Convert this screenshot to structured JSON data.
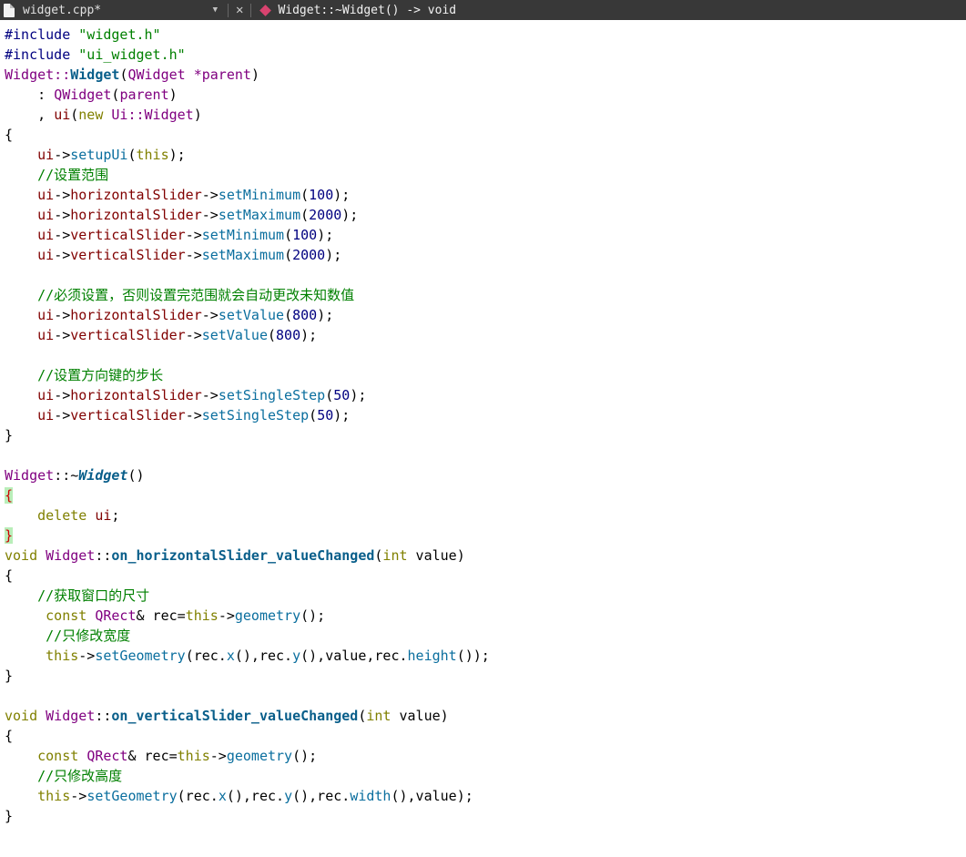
{
  "titlebar": {
    "file_tab": "widget.cpp*",
    "context": "Widget::~Widget() -> void",
    "icons": {
      "file": "document-icon",
      "dropdown_glyph": "▼",
      "close_glyph": "✕",
      "symbol": "function-diamond-icon"
    }
  },
  "colors": {
    "titlebar_bg": "#383838",
    "editor_bg": "#ffffff",
    "diamond": "#d9436f",
    "keyword": "#808000",
    "preprocessor": "#000080",
    "number": "#000080",
    "string": "#008000",
    "comment": "#008000",
    "type": "#800080",
    "field": "#800000",
    "function": "#0a6e9e",
    "function_decl": "#085e8a",
    "brace_match": "#d00000",
    "brace_match_bg": "#b9eeb9"
  },
  "code": {
    "language": "cpp",
    "lines": [
      {
        "tokens": [
          [
            "pp",
            "#include"
          ],
          [
            "pl",
            " "
          ],
          [
            "str",
            "\"widget.h\""
          ]
        ]
      },
      {
        "tokens": [
          [
            "pp",
            "#include"
          ],
          [
            "pl",
            " "
          ],
          [
            "str",
            "\"ui_widget.h\""
          ]
        ]
      },
      {
        "tokens": [
          [
            "type",
            "Widget::"
          ],
          [
            "fndecl",
            "Widget"
          ],
          [
            "pl",
            "("
          ],
          [
            "type",
            "QWidget *parent"
          ],
          [
            "pl",
            ")"
          ]
        ]
      },
      {
        "tokens": [
          [
            "pl",
            "    : "
          ],
          [
            "type",
            "QWidget"
          ],
          [
            "pl",
            "("
          ],
          [
            "type",
            "parent"
          ],
          [
            "pl",
            ")"
          ]
        ]
      },
      {
        "tokens": [
          [
            "pl",
            "    , "
          ],
          [
            "field",
            "ui"
          ],
          [
            "pl",
            "("
          ],
          [
            "kw",
            "new"
          ],
          [
            "pl",
            " "
          ],
          [
            "type",
            "Ui::Widget"
          ],
          [
            "pl",
            ")"
          ]
        ]
      },
      {
        "tokens": [
          [
            "pl",
            "{"
          ]
        ]
      },
      {
        "tokens": [
          [
            "pl",
            "    "
          ],
          [
            "field",
            "ui"
          ],
          [
            "pl",
            "->"
          ],
          [
            "fn",
            "setupUi"
          ],
          [
            "pl",
            "("
          ],
          [
            "kw",
            "this"
          ],
          [
            "pl",
            ");"
          ]
        ]
      },
      {
        "tokens": [
          [
            "cmt",
            "    //设置范围"
          ]
        ]
      },
      {
        "tokens": [
          [
            "pl",
            "    "
          ],
          [
            "field",
            "ui"
          ],
          [
            "pl",
            "->"
          ],
          [
            "field",
            "horizontalSlider"
          ],
          [
            "pl",
            "->"
          ],
          [
            "fn",
            "setMinimum"
          ],
          [
            "pl",
            "("
          ],
          [
            "num",
            "100"
          ],
          [
            "pl",
            ");"
          ]
        ]
      },
      {
        "tokens": [
          [
            "pl",
            "    "
          ],
          [
            "field",
            "ui"
          ],
          [
            "pl",
            "->"
          ],
          [
            "field",
            "horizontalSlider"
          ],
          [
            "pl",
            "->"
          ],
          [
            "fn",
            "setMaximum"
          ],
          [
            "pl",
            "("
          ],
          [
            "num",
            "2000"
          ],
          [
            "pl",
            ");"
          ]
        ]
      },
      {
        "tokens": [
          [
            "pl",
            "    "
          ],
          [
            "field",
            "ui"
          ],
          [
            "pl",
            "->"
          ],
          [
            "field",
            "verticalSlider"
          ],
          [
            "pl",
            "->"
          ],
          [
            "fn",
            "setMinimum"
          ],
          [
            "pl",
            "("
          ],
          [
            "num",
            "100"
          ],
          [
            "pl",
            ");"
          ]
        ]
      },
      {
        "tokens": [
          [
            "pl",
            "    "
          ],
          [
            "field",
            "ui"
          ],
          [
            "pl",
            "->"
          ],
          [
            "field",
            "verticalSlider"
          ],
          [
            "pl",
            "->"
          ],
          [
            "fn",
            "setMaximum"
          ],
          [
            "pl",
            "("
          ],
          [
            "num",
            "2000"
          ],
          [
            "pl",
            ");"
          ]
        ]
      },
      {
        "tokens": []
      },
      {
        "tokens": [
          [
            "cmt",
            "    //必须设置，否则设置完范围就会自动更改未知数值"
          ]
        ]
      },
      {
        "tokens": [
          [
            "pl",
            "    "
          ],
          [
            "field",
            "ui"
          ],
          [
            "pl",
            "->"
          ],
          [
            "field",
            "horizontalSlider"
          ],
          [
            "pl",
            "->"
          ],
          [
            "fn",
            "setValue"
          ],
          [
            "pl",
            "("
          ],
          [
            "num",
            "800"
          ],
          [
            "pl",
            ");"
          ]
        ]
      },
      {
        "tokens": [
          [
            "pl",
            "    "
          ],
          [
            "field",
            "ui"
          ],
          [
            "pl",
            "->"
          ],
          [
            "field",
            "verticalSlider"
          ],
          [
            "pl",
            "->"
          ],
          [
            "fn",
            "setValue"
          ],
          [
            "pl",
            "("
          ],
          [
            "num",
            "800"
          ],
          [
            "pl",
            ");"
          ]
        ]
      },
      {
        "tokens": []
      },
      {
        "tokens": [
          [
            "cmt",
            "    //设置方向键的步长"
          ]
        ]
      },
      {
        "tokens": [
          [
            "pl",
            "    "
          ],
          [
            "field",
            "ui"
          ],
          [
            "pl",
            "->"
          ],
          [
            "field",
            "horizontalSlider"
          ],
          [
            "pl",
            "->"
          ],
          [
            "fn",
            "setSingleStep"
          ],
          [
            "pl",
            "("
          ],
          [
            "num",
            "50"
          ],
          [
            "pl",
            ");"
          ]
        ]
      },
      {
        "tokens": [
          [
            "pl",
            "    "
          ],
          [
            "field",
            "ui"
          ],
          [
            "pl",
            "->"
          ],
          [
            "field",
            "verticalSlider"
          ],
          [
            "pl",
            "->"
          ],
          [
            "fn",
            "setSingleStep"
          ],
          [
            "pl",
            "("
          ],
          [
            "num",
            "50"
          ],
          [
            "pl",
            ");"
          ]
        ]
      },
      {
        "tokens": [
          [
            "pl",
            "}"
          ]
        ]
      },
      {
        "tokens": []
      },
      {
        "tokens": [
          [
            "type",
            "Widget"
          ],
          [
            "pl",
            "::~"
          ],
          [
            "virt",
            "Widget"
          ],
          [
            "pl",
            "()"
          ]
        ]
      },
      {
        "tokens": [
          [
            "hl",
            "{"
          ]
        ]
      },
      {
        "tokens": [
          [
            "pl",
            "    "
          ],
          [
            "kw",
            "delete"
          ],
          [
            "pl",
            " "
          ],
          [
            "field",
            "ui"
          ],
          [
            "pl",
            ";"
          ]
        ]
      },
      {
        "tokens": [
          [
            "hl",
            "}"
          ]
        ]
      },
      {
        "tokens": [
          [
            "kw",
            "void"
          ],
          [
            "pl",
            " "
          ],
          [
            "type",
            "Widget"
          ],
          [
            "pl",
            "::"
          ],
          [
            "fndecl",
            "on_horizontalSlider_valueChanged"
          ],
          [
            "pl",
            "("
          ],
          [
            "kw",
            "int"
          ],
          [
            "pl",
            " value)"
          ]
        ]
      },
      {
        "tokens": [
          [
            "pl",
            "{"
          ]
        ]
      },
      {
        "tokens": [
          [
            "cmt",
            "    //获取窗口的尺寸"
          ]
        ]
      },
      {
        "tokens": [
          [
            "pl",
            "     "
          ],
          [
            "kw",
            "const"
          ],
          [
            "pl",
            " "
          ],
          [
            "type",
            "QRect"
          ],
          [
            "pl",
            "& rec="
          ],
          [
            "kw",
            "this"
          ],
          [
            "pl",
            "->"
          ],
          [
            "fn",
            "geometry"
          ],
          [
            "pl",
            "();"
          ]
        ]
      },
      {
        "tokens": [
          [
            "cmt",
            "     //只修改宽度"
          ]
        ]
      },
      {
        "tokens": [
          [
            "pl",
            "     "
          ],
          [
            "kw",
            "this"
          ],
          [
            "pl",
            "->"
          ],
          [
            "fn",
            "setGeometry"
          ],
          [
            "pl",
            "(rec."
          ],
          [
            "fn",
            "x"
          ],
          [
            "pl",
            "(),rec."
          ],
          [
            "fn",
            "y"
          ],
          [
            "pl",
            "(),value,rec."
          ],
          [
            "fn",
            "height"
          ],
          [
            "pl",
            "());"
          ]
        ]
      },
      {
        "tokens": [
          [
            "pl",
            "}"
          ]
        ]
      },
      {
        "tokens": []
      },
      {
        "tokens": [
          [
            "kw",
            "void"
          ],
          [
            "pl",
            " "
          ],
          [
            "type",
            "Widget"
          ],
          [
            "pl",
            "::"
          ],
          [
            "fndecl",
            "on_verticalSlider_valueChanged"
          ],
          [
            "pl",
            "("
          ],
          [
            "kw",
            "int"
          ],
          [
            "pl",
            " value)"
          ]
        ]
      },
      {
        "tokens": [
          [
            "pl",
            "{"
          ]
        ]
      },
      {
        "tokens": [
          [
            "pl",
            "    "
          ],
          [
            "kw",
            "const"
          ],
          [
            "pl",
            " "
          ],
          [
            "type",
            "QRect"
          ],
          [
            "pl",
            "& rec="
          ],
          [
            "kw",
            "this"
          ],
          [
            "pl",
            "->"
          ],
          [
            "fn",
            "geometry"
          ],
          [
            "pl",
            "();"
          ]
        ]
      },
      {
        "tokens": [
          [
            "cmt",
            "    //只修改高度"
          ]
        ]
      },
      {
        "tokens": [
          [
            "pl",
            "    "
          ],
          [
            "kw",
            "this"
          ],
          [
            "pl",
            "->"
          ],
          [
            "fn",
            "setGeometry"
          ],
          [
            "pl",
            "(rec."
          ],
          [
            "fn",
            "x"
          ],
          [
            "pl",
            "(),rec."
          ],
          [
            "fn",
            "y"
          ],
          [
            "pl",
            "(),rec."
          ],
          [
            "fn",
            "width"
          ],
          [
            "pl",
            "(),value);"
          ]
        ]
      },
      {
        "tokens": [
          [
            "pl",
            "}"
          ]
        ]
      }
    ]
  }
}
